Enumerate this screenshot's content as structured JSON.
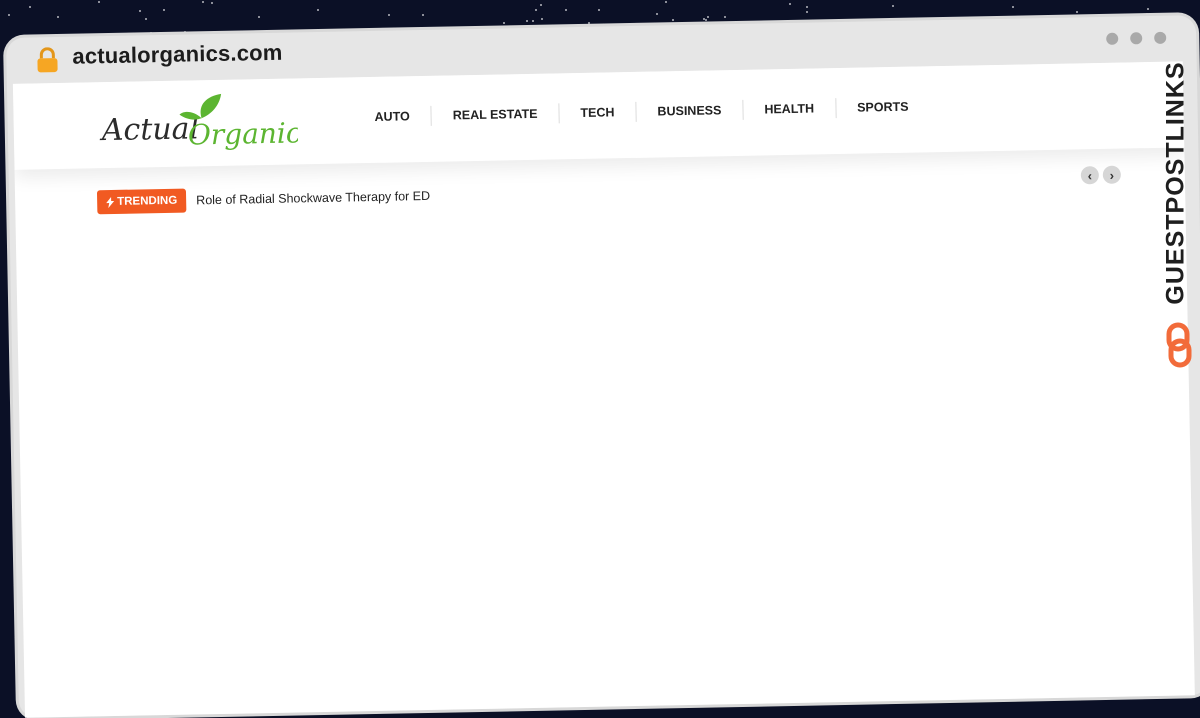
{
  "browser": {
    "url": "actualorganics.com",
    "lock_icon": "lock-icon",
    "window_dots": 3
  },
  "site": {
    "logo_text_dark": "Actual",
    "logo_text_green": "Organics",
    "nav": [
      "AUTO",
      "REAL ESTATE",
      "TECH",
      "BUSINESS",
      "HEALTH",
      "SPORTS"
    ],
    "trending": {
      "label": "TRENDING",
      "headline": "Role of Radial Shockwave Therapy for ED"
    },
    "prev_arrow": "‹",
    "next_arrow": "›"
  },
  "watermark": {
    "text": "GUESTPOSTLINKS",
    "icon": "link-icon"
  },
  "colors": {
    "accent_orange": "#f15a22",
    "logo_green": "#5cb531",
    "lock_orange": "#f6a623"
  }
}
